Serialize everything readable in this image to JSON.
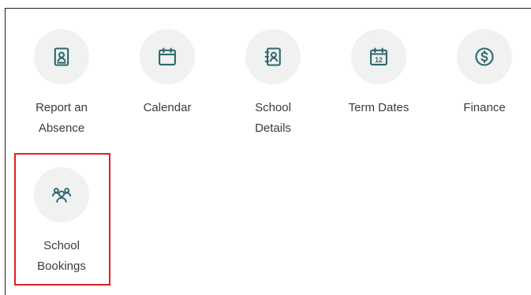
{
  "colors": {
    "icon": "#2d6870",
    "icon_bg": "#f0f1f1",
    "text": "#3b3b3b",
    "highlight": "#e02020"
  },
  "tiles": [
    {
      "label": "Report an\nAbsence",
      "icon": "id-badge-icon"
    },
    {
      "label": "Calendar",
      "icon": "calendar-icon"
    },
    {
      "label": "School\nDetails",
      "icon": "contact-book-icon"
    },
    {
      "label": "Term Dates",
      "icon": "calendar-12-icon"
    },
    {
      "label": "Finance",
      "icon": "dollar-circle-icon"
    },
    {
      "label": "School\nBookings",
      "icon": "group-icon"
    }
  ]
}
